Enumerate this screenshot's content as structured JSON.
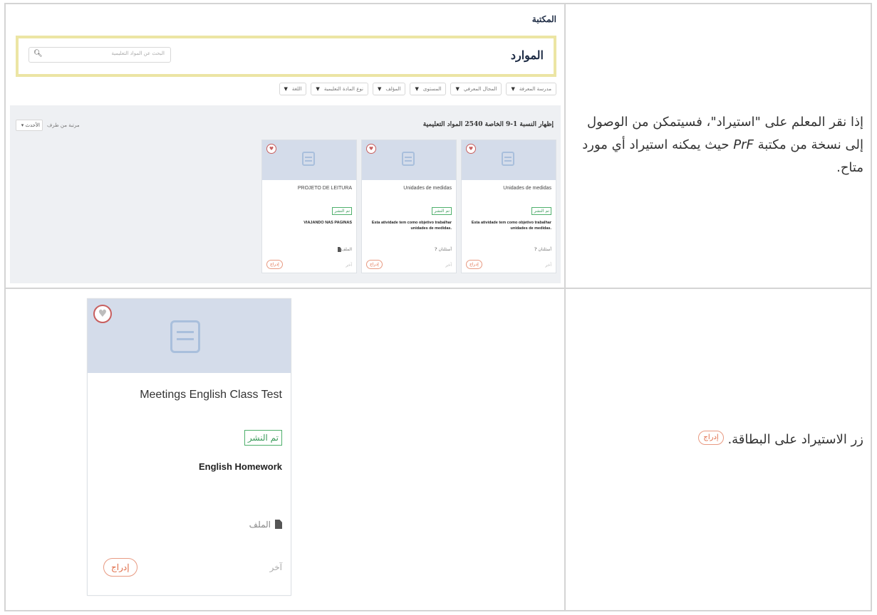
{
  "row1": {
    "library": {
      "title": "المكتبة",
      "resources_label": "الموارد",
      "search_placeholder": "البحث عن المواد التعليمية",
      "filters": [
        "مدرسة المعرفة",
        "المجال المعرفي",
        "المستوى",
        "المؤلف",
        "نوع المادة التعليمية",
        "اللغة"
      ],
      "results_count": "إظهار النسبة 1-9 الخاصة 2540 المواد التعليمية",
      "sort_label": "مرتبة من طرف",
      "sort_value": "الأحدث",
      "cards": [
        {
          "title": "Unidades de medidas",
          "status": "تم النشر",
          "description": "Esta atividade tem como objetivo trabalhar unidades de medidas.",
          "meta": "أسئلتان",
          "other": "آخر",
          "button": "إدراج"
        },
        {
          "title": "Unidades de medidas",
          "status": "تم النشر",
          "description": "Esta atividade tem como objetivo trabalhar unidades de medidas.",
          "meta": "أسئلتان",
          "other": "آخر",
          "button": "إدراج"
        },
        {
          "title": "PROJETO DE LEITURA",
          "status": "تم النشر",
          "description": "VIAJANDO NAS PAGINAS",
          "meta": "الملف",
          "other": "آخر",
          "button": "إدراج"
        }
      ]
    },
    "description_part1": "إذا نقر المعلم على \"استيراد\"، فسيتمكن من الوصول إلى نسخة من مكتبة",
    "description_em": "PrF",
    "description_part2": "حيث يمكنه استيراد أي مورد متاح."
  },
  "row2": {
    "card": {
      "title": "Meetings English Class Test",
      "status": "تم النشر",
      "description": "English Homework",
      "meta": "الملف",
      "other": "آخر",
      "button": "إدراج"
    },
    "pill": "إدراج",
    "description": "زر الاستيراد على البطاقة."
  }
}
